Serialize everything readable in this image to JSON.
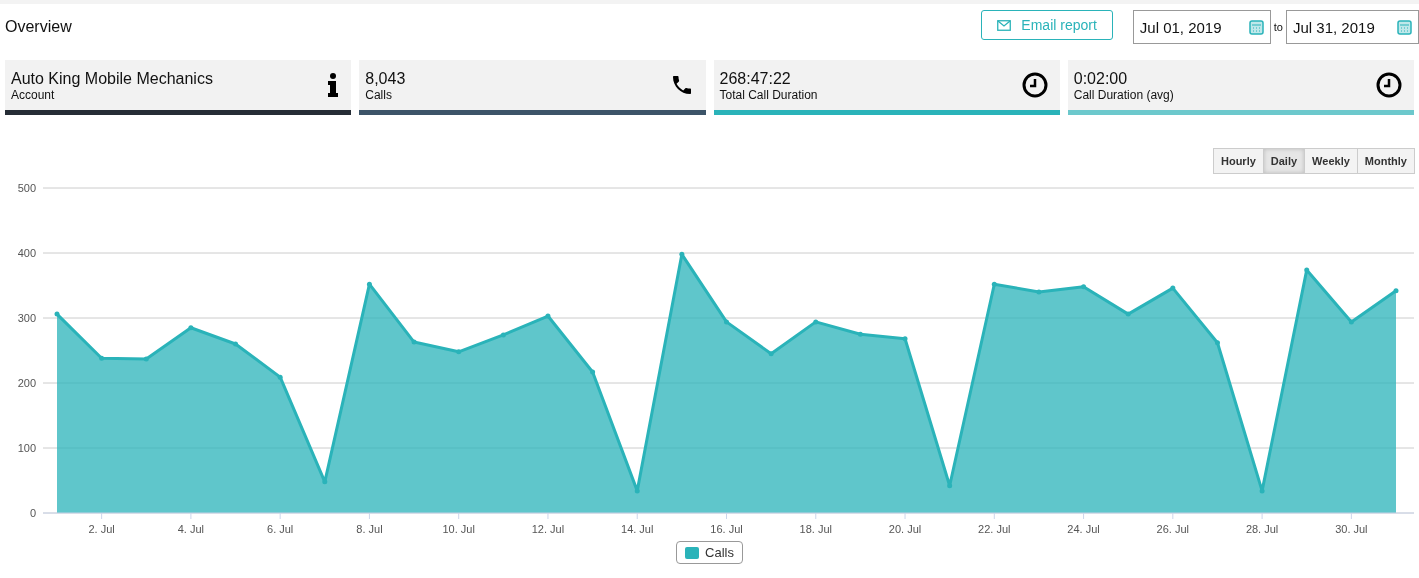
{
  "header": {
    "title": "Overview",
    "email_button": "Email report",
    "date_from": "Jul 01, 2019",
    "date_separator": "to",
    "date_to": "Jul 31, 2019"
  },
  "cards": [
    {
      "kind": "account",
      "value": "Auto King Mobile Mechanics",
      "label": "Account",
      "color": "#262d36"
    },
    {
      "kind": "calls",
      "value": "8,043",
      "label": "Calls",
      "color": "#3c5468"
    },
    {
      "kind": "duration",
      "value": "268:47:22",
      "label": "Total Call Duration",
      "color": "#2ab3b9"
    },
    {
      "kind": "duration",
      "value": "0:02:00",
      "label": "Call Duration (avg)",
      "color": "#6cc8cc"
    }
  ],
  "intervals": [
    {
      "label": "Hourly",
      "selected": false
    },
    {
      "label": "Daily",
      "selected": true
    },
    {
      "label": "Weekly",
      "selected": false
    },
    {
      "label": "Monthly",
      "selected": false
    }
  ],
  "chart_data": {
    "type": "area",
    "categories": [
      null,
      "2. Jul",
      null,
      "4. Jul",
      null,
      "6. Jul",
      null,
      "8. Jul",
      null,
      "10. Jul",
      null,
      "12. Jul",
      null,
      "14. Jul",
      null,
      "16. Jul",
      null,
      "18. Jul",
      null,
      "20. Jul",
      null,
      "22. Jul",
      null,
      "24. Jul",
      null,
      "26. Jul",
      null,
      "28. Jul",
      null,
      "30. Jul",
      null
    ],
    "ylim": [
      0,
      500
    ],
    "grid": true,
    "yticks": [
      0,
      100,
      200,
      300,
      400,
      500
    ],
    "series": [
      {
        "name": "Calls",
        "color": "#2ab3b9",
        "values": [
          306,
          238,
          237,
          285,
          260,
          209,
          48,
          352,
          263,
          248,
          274,
          303,
          217,
          34,
          398,
          294,
          245,
          294,
          275,
          268,
          42,
          352,
          340,
          348,
          306,
          346,
          262,
          34,
          374,
          294,
          342
        ]
      }
    ]
  }
}
